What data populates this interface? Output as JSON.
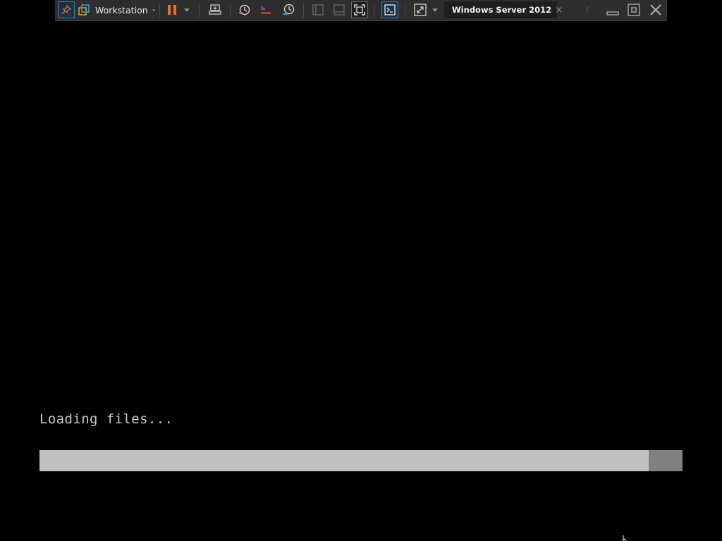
{
  "toolbar": {
    "product_label": "Workstation",
    "vm_tab_title": "Windows Server 2012",
    "vm_tab_close": "×"
  },
  "icons": {
    "pin": "pin-icon",
    "library": "library-icon",
    "product_dropdown": "chevron-down-icon",
    "pause": "pause-icon",
    "power_caret": "caret-down-icon",
    "send_keys": "send-ctrl-alt-del-icon",
    "snapshot": "take-snapshot-icon",
    "revert": "revert-snapshot-icon",
    "snapshot_manager": "snapshot-manager-icon",
    "view_library": "view-library-icon",
    "view_thumbnail": "view-thumbnail-icon",
    "fullscreen": "fullscreen-icon",
    "console": "console-view-icon",
    "stretch": "stretch-guest-icon",
    "vm": "vm-running-icon",
    "minimize": "minimize-icon",
    "restore": "restore-icon",
    "close": "close-icon"
  },
  "colors": {
    "toolbar_bg": "#2e2e2e",
    "accent_orange": "#e8702a",
    "accent_blue": "#3d78a8",
    "screen_bg": "#000000",
    "progress_fill": "#c0c0c0",
    "progress_track": "#808080",
    "text": "#c8c8c8"
  },
  "boot": {
    "status_text": "Loading files...",
    "progress": 0.947
  }
}
